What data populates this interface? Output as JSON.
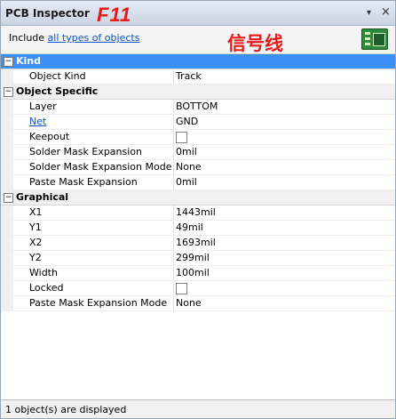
{
  "window": {
    "title": "PCB Inspector",
    "overlay_key": "F11",
    "overlay_chinese": "信号线",
    "pin_button": "▾",
    "close_button": "×"
  },
  "include": {
    "prefix": "Include",
    "link": "all types of objects"
  },
  "categories": [
    {
      "label": "Kind",
      "toggle": "−",
      "selected": true,
      "rows": [
        {
          "name": "Object Kind",
          "value": "Track"
        }
      ]
    },
    {
      "label": "Object Specific",
      "toggle": "−",
      "selected": false,
      "rows": [
        {
          "name": "Layer",
          "value": "BOTTOM"
        },
        {
          "name": "Net",
          "value": "GND"
        },
        {
          "name": "Keepout",
          "value": ""
        },
        {
          "name": "Solder Mask Expansion",
          "value": "0mil"
        },
        {
          "name": "Solder Mask Expansion Mode",
          "value": "None"
        },
        {
          "name": "Paste Mask Expansion",
          "value": "0mil"
        }
      ]
    },
    {
      "label": "Graphical",
      "toggle": "−",
      "selected": false,
      "rows": [
        {
          "name": "X1",
          "value": "1443mil"
        },
        {
          "name": "Y1",
          "value": "49mil"
        },
        {
          "name": "X2",
          "value": "1693mil"
        },
        {
          "name": "Y2",
          "value": "299mil"
        },
        {
          "name": "Width",
          "value": "100mil"
        },
        {
          "name": "Locked",
          "value": ""
        },
        {
          "name": "Paste Mask Expansion Mode",
          "value": "None"
        }
      ]
    }
  ],
  "status": {
    "text": "1 object(s) are displayed"
  },
  "colors": {
    "selected_category": "#3b8ff5",
    "link": "#0b55c4",
    "overlay_red": "#e31b1b"
  }
}
